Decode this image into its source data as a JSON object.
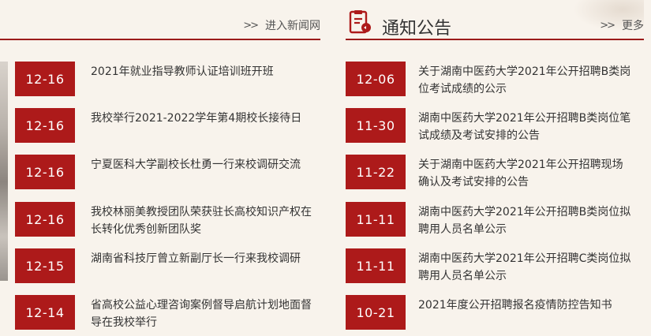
{
  "news": {
    "more_label": "进入新闻网",
    "items": [
      {
        "date": "12-16",
        "title": "2021年就业指导教师认证培训班开班"
      },
      {
        "date": "12-16",
        "title": "我校举行2021-2022学年第4期校长接待日"
      },
      {
        "date": "12-16",
        "title": "宁夏医科大学副校长杜勇一行来校调研交流"
      },
      {
        "date": "12-16",
        "title": "我校林丽美教授团队荣获驻长高校知识产权在长转化优秀创新团队奖"
      },
      {
        "date": "12-15",
        "title": "湖南省科技厅曾立新副厅长一行来我校调研"
      },
      {
        "date": "12-14",
        "title": "省高校公益心理咨询案例督导启航计划地面督导在我校举行"
      }
    ]
  },
  "notice": {
    "title": "通知公告",
    "more_label": "更多",
    "icon": "notice-document-icon",
    "items": [
      {
        "date": "12-06",
        "title": "关于湖南中医药大学2021年公开招聘B类岗位考试成绩的公示"
      },
      {
        "date": "11-30",
        "title": "湖南中医药大学2021年公开招聘B类岗位笔试成绩及考试安排的公告"
      },
      {
        "date": "11-22",
        "title": "关于湖南中医药大学2021年公开招聘现场确认及考试安排的公告"
      },
      {
        "date": "11-11",
        "title": "湖南中医药大学2021年公开招聘B类岗位拟聘用人员名单公示"
      },
      {
        "date": "11-11",
        "title": "湖南中医药大学2021年公开招聘C类岗位拟聘用人员名单公示"
      },
      {
        "date": "10-21",
        "title": "2021年度公开招聘报名疫情防控告知书"
      }
    ]
  },
  "colors": {
    "accent": "#ad1a1a",
    "background": "#f8f3ec",
    "rule": "#9b1b1b"
  }
}
